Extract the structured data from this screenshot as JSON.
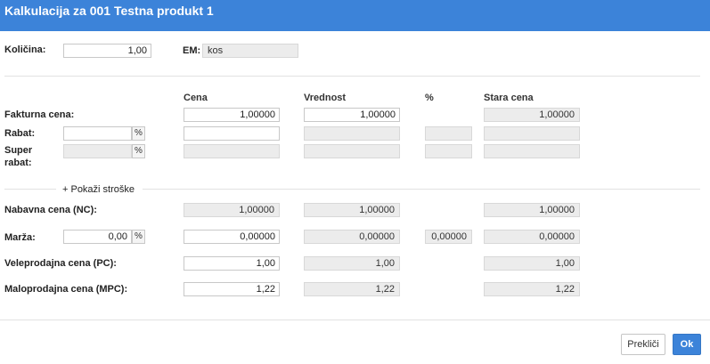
{
  "dialog": {
    "title": "Kalkulacija za 001 Testna produkt 1"
  },
  "quantity": {
    "label": "Količina:",
    "value": "1,00"
  },
  "unit": {
    "label": "EM:",
    "value": "kos"
  },
  "columns": {
    "cena": "Cena",
    "vrednost": "Vrednost",
    "percent": "%",
    "stara_cena": "Stara cena"
  },
  "rows": {
    "fakturna": {
      "label": "Fakturna cena:",
      "cena": "1,00000",
      "vrednost": "1,00000",
      "stara": "1,00000"
    },
    "rabat": {
      "label": "Rabat:",
      "pct_symbol": "%",
      "value": "",
      "cena": ""
    },
    "super_rabat": {
      "label_line1": "Super",
      "label_line2": "rabat:",
      "pct_symbol": "%"
    },
    "show_costs": {
      "label": "+ Pokaži stroške"
    },
    "nabavna": {
      "label": "Nabavna cena (NC):",
      "cena": "1,00000",
      "vrednost": "1,00000",
      "stara": "1,00000"
    },
    "marza": {
      "label": "Marža:",
      "value": "0,00",
      "pct_symbol": "%",
      "cena": "0,00000",
      "vrednost": "0,00000",
      "percent": "0,00000",
      "stara": "0,00000"
    },
    "veleprodajna": {
      "label": "Veleprodajna cena (PC):",
      "cena": "1,00",
      "vrednost": "1,00",
      "stara": "1,00"
    },
    "maloprodajna": {
      "label": "Maloprodajna cena (MPC):",
      "cena": "1,22",
      "vrednost": "1,22",
      "stara": "1,22"
    }
  },
  "footer": {
    "cancel_label": "Prekliči",
    "ok_label": "Ok"
  }
}
